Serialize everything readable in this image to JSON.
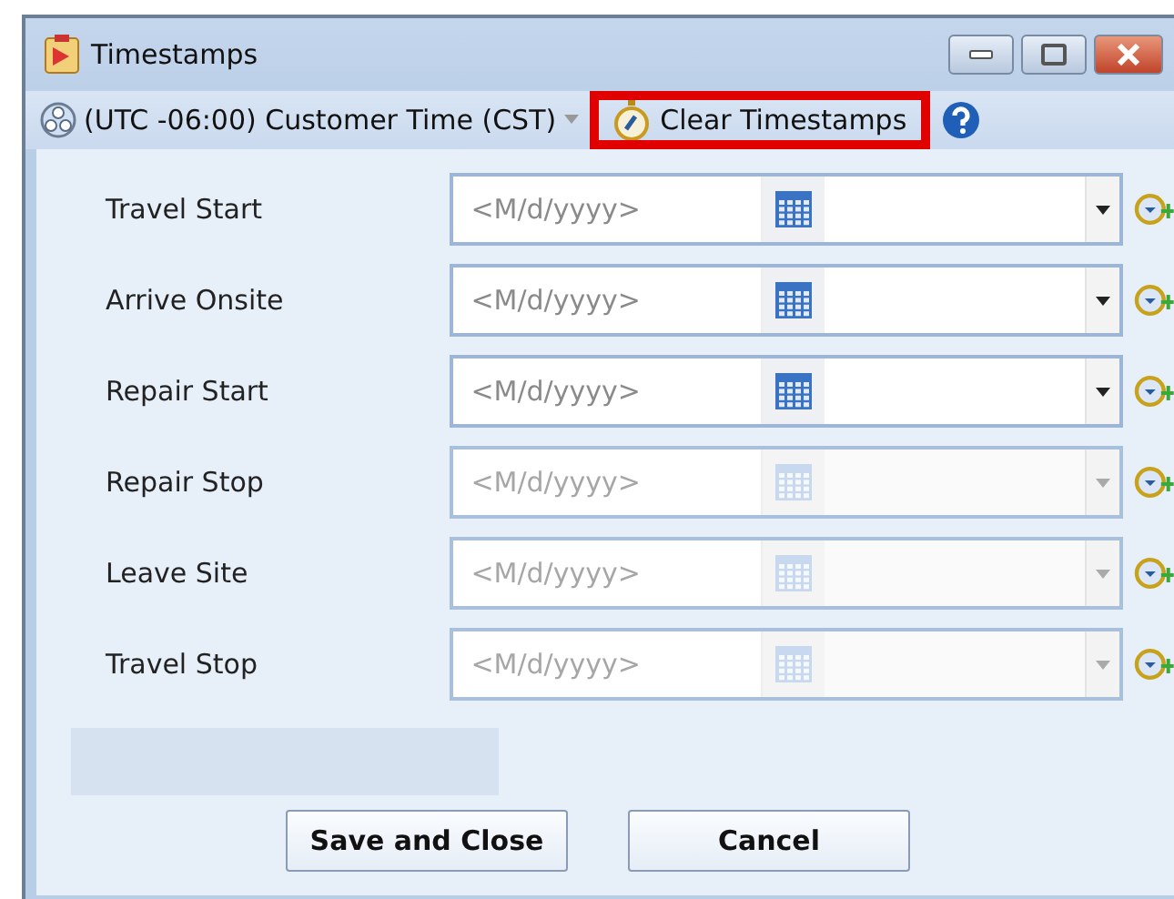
{
  "window": {
    "title": "Timestamps"
  },
  "toolbar": {
    "timezone": "(UTC -06:00) Customer Time (CST)",
    "clear_button": {
      "label": "Clear Timestamps",
      "highlighted": true
    }
  },
  "rows": [
    {
      "label": "Travel Start",
      "placeholder": "<M/d/yyyy>",
      "disabled": false
    },
    {
      "label": "Arrive Onsite",
      "placeholder": "<M/d/yyyy>",
      "disabled": false
    },
    {
      "label": "Repair Start",
      "placeholder": "<M/d/yyyy>",
      "disabled": false
    },
    {
      "label": "Repair Stop",
      "placeholder": "<M/d/yyyy>",
      "disabled": true
    },
    {
      "label": "Leave Site",
      "placeholder": "<M/d/yyyy>",
      "disabled": true
    },
    {
      "label": "Travel Stop",
      "placeholder": "<M/d/yyyy>",
      "disabled": true
    }
  ],
  "buttons": [
    "Save and Close",
    "Cancel"
  ]
}
